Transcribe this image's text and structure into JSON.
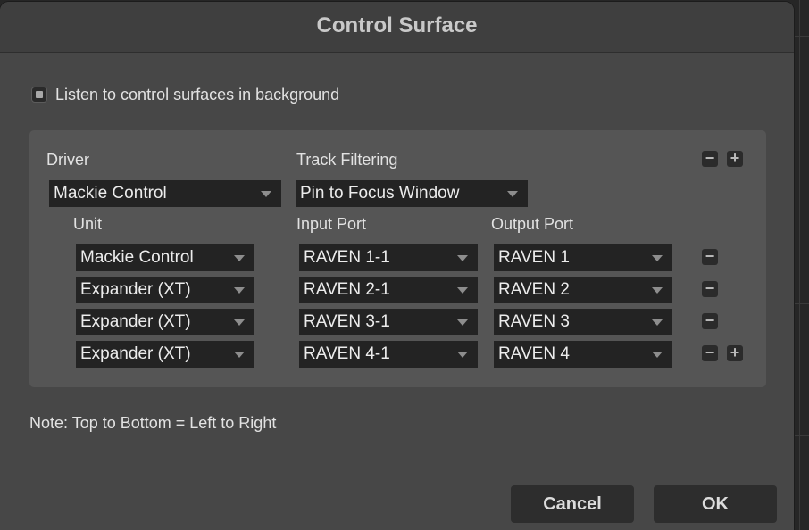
{
  "dialog": {
    "title": "Control Surface"
  },
  "listen": {
    "label": "Listen to control surfaces in background",
    "checked": true
  },
  "driver": {
    "label": "Driver",
    "value": "Mackie Control"
  },
  "track_filtering": {
    "label": "Track Filtering",
    "value": "Pin to Focus Window"
  },
  "columns": {
    "unit": "Unit",
    "input_port": "Input Port",
    "output_port": "Output Port"
  },
  "rows": [
    {
      "unit": "Mackie Control",
      "input": "RAVEN 1-1",
      "output": "RAVEN 1"
    },
    {
      "unit": "Expander (XT)",
      "input": "RAVEN 2-1",
      "output": "RAVEN 2"
    },
    {
      "unit": "Expander (XT)",
      "input": "RAVEN 3-1",
      "output": "RAVEN 3"
    },
    {
      "unit": "Expander (XT)",
      "input": "RAVEN 4-1",
      "output": "RAVEN 4"
    }
  ],
  "glyphs": {
    "minus": "−",
    "plus": "+"
  },
  "note": "Note: Top to Bottom = Left to Right",
  "buttons": {
    "cancel": "Cancel",
    "ok": "OK"
  }
}
